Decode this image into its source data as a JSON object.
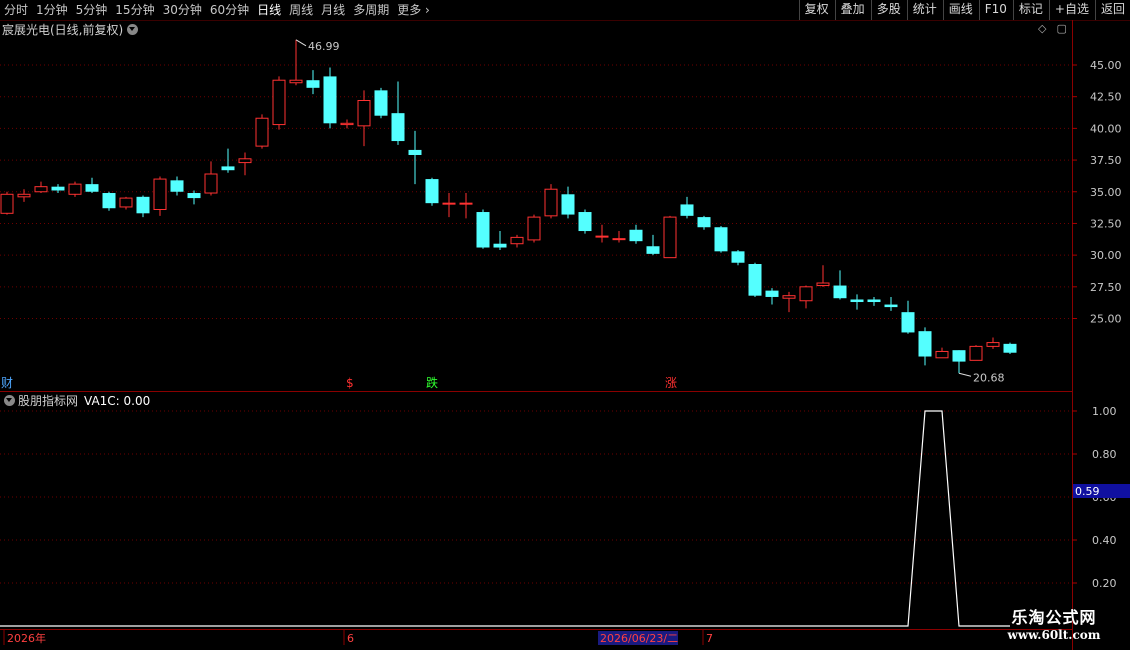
{
  "toolbar": {
    "periods": [
      "分时",
      "1分钟",
      "5分钟",
      "15分钟",
      "30分钟",
      "60分钟",
      "日线",
      "周线",
      "月线",
      "多周期",
      "更多"
    ],
    "active_period": "日线",
    "actions": [
      "复权",
      "叠加",
      "多股",
      "统计",
      "画线",
      "F10",
      "标记",
      "+自选",
      "返回"
    ]
  },
  "stock_title": "宸展光电(日线,前复权)",
  "indicator_title": "股朋指标网",
  "indicator_value": "VA1C: 0.00",
  "current_value_badge": "0.59",
  "markers": [
    {
      "text": "财",
      "color": "#4fa8ff"
    },
    {
      "text": "$",
      "color": "#ff3030"
    },
    {
      "text": "跌",
      "color": "#30ff30"
    },
    {
      "text": "涨",
      "color": "#ff3030"
    }
  ],
  "time_axis": [
    "2026年",
    "6",
    "2026/06/23/二",
    "7"
  ],
  "watermark": {
    "line1": "乐淘公式网",
    "line2": "www.60lt.com"
  },
  "colors": {
    "up": "#ff3232",
    "down": "#54ffff",
    "grid": "#6e0000",
    "line": "#ffffff",
    "badge": "#1010a0"
  },
  "chart_data": [
    {
      "type": "candlestick",
      "ylim": [
        20,
        47.5
      ],
      "y_ticks": [
        25.0,
        27.5,
        30.0,
        32.5,
        35.0,
        37.5,
        40.0,
        42.5,
        45.0
      ],
      "max_label": "46.99",
      "min_label": "20.68",
      "candles": [
        [
          33.3,
          34.8,
          35.0,
          33.2
        ],
        [
          34.6,
          34.8,
          35.2,
          34.2
        ],
        [
          35.0,
          35.4,
          35.8,
          34.9
        ],
        [
          35.4,
          35.1,
          35.6,
          34.9
        ],
        [
          34.8,
          35.6,
          35.8,
          34.6
        ],
        [
          35.6,
          35.0,
          36.1,
          34.9
        ],
        [
          34.9,
          33.7,
          35.0,
          33.5
        ],
        [
          33.8,
          34.5,
          34.6,
          33.6
        ],
        [
          34.6,
          33.3,
          34.7,
          33.0
        ],
        [
          33.6,
          36.0,
          36.2,
          33.1
        ],
        [
          35.9,
          35.0,
          36.2,
          34.7
        ],
        [
          34.9,
          34.5,
          35.1,
          34.0
        ],
        [
          34.9,
          36.4,
          37.4,
          34.7
        ],
        [
          37.0,
          36.7,
          38.4,
          36.5
        ],
        [
          37.3,
          37.6,
          38.1,
          36.3
        ],
        [
          38.6,
          40.8,
          41.1,
          38.4
        ],
        [
          40.3,
          43.8,
          44.1,
          39.9
        ],
        [
          43.6,
          43.8,
          46.99,
          43.4
        ],
        [
          43.8,
          43.2,
          44.6,
          42.7
        ],
        [
          44.1,
          40.4,
          44.8,
          40.0
        ],
        [
          40.3,
          40.4,
          40.7,
          40.0
        ],
        [
          40.2,
          42.2,
          43.0,
          38.6
        ],
        [
          43.0,
          41.0,
          43.2,
          40.8
        ],
        [
          41.2,
          39.0,
          43.7,
          38.7
        ],
        [
          38.3,
          37.9,
          39.8,
          35.6
        ],
        [
          36.0,
          34.1,
          36.1,
          33.9
        ],
        [
          34.1,
          34.1,
          34.9,
          33.0
        ],
        [
          34.1,
          34.1,
          34.9,
          32.9
        ],
        [
          33.4,
          30.6,
          33.6,
          30.5
        ],
        [
          30.9,
          30.6,
          31.9,
          30.4
        ],
        [
          30.9,
          31.4,
          31.6,
          30.6
        ],
        [
          31.2,
          33.0,
          33.2,
          31.0
        ],
        [
          33.1,
          35.2,
          35.6,
          32.9
        ],
        [
          34.8,
          33.2,
          35.4,
          32.9
        ],
        [
          33.4,
          31.9,
          33.6,
          31.7
        ],
        [
          31.5,
          31.5,
          32.4,
          31.0
        ],
        [
          31.3,
          31.3,
          31.9,
          31.0
        ],
        [
          32.0,
          31.1,
          32.4,
          30.9
        ],
        [
          30.7,
          30.1,
          31.6,
          30.0
        ],
        [
          29.8,
          33.0,
          33.1,
          29.8
        ],
        [
          34.0,
          33.1,
          34.6,
          32.9
        ],
        [
          33.0,
          32.2,
          33.1,
          32.0
        ],
        [
          32.2,
          30.3,
          32.3,
          30.2
        ],
        [
          30.3,
          29.4,
          30.4,
          29.2
        ],
        [
          29.3,
          26.8,
          29.4,
          26.7
        ],
        [
          27.2,
          26.7,
          27.4,
          26.1
        ],
        [
          26.6,
          26.8,
          27.1,
          25.5
        ],
        [
          26.4,
          27.5,
          27.6,
          25.8
        ],
        [
          27.6,
          27.8,
          29.2,
          27.5
        ],
        [
          27.6,
          26.6,
          28.8,
          26.5
        ],
        [
          26.5,
          26.3,
          26.9,
          25.7
        ],
        [
          26.5,
          26.3,
          26.7,
          26.0
        ],
        [
          26.1,
          25.9,
          26.7,
          25.6
        ],
        [
          25.5,
          23.9,
          26.4,
          23.8
        ],
        [
          24.0,
          22.0,
          24.3,
          21.3
        ],
        [
          21.9,
          22.4,
          22.7,
          21.9
        ],
        [
          22.5,
          21.6,
          22.5,
          20.68
        ],
        [
          21.7,
          22.8,
          22.9,
          21.7
        ],
        [
          22.8,
          23.1,
          23.5,
          22.6
        ],
        [
          23.0,
          22.3,
          23.1,
          22.2
        ]
      ]
    },
    {
      "type": "line",
      "name": "VA1C",
      "ylim": [
        0.1,
        1.1
      ],
      "y_ticks": [
        0.2,
        0.4,
        0.6,
        0.8,
        1.0
      ],
      "values": [
        0,
        0,
        0,
        0,
        0,
        0,
        0,
        0,
        0,
        0,
        0,
        0,
        0,
        0,
        0,
        0,
        0,
        0,
        0,
        0,
        0,
        0,
        0,
        0,
        0,
        0,
        0,
        0,
        0,
        0,
        0,
        0,
        0,
        0,
        0,
        0,
        0,
        0,
        0,
        0,
        0,
        0,
        0,
        0,
        0,
        0,
        0,
        0,
        0,
        0,
        0,
        0,
        0,
        0,
        1,
        1,
        0,
        0,
        0,
        0
      ]
    }
  ]
}
